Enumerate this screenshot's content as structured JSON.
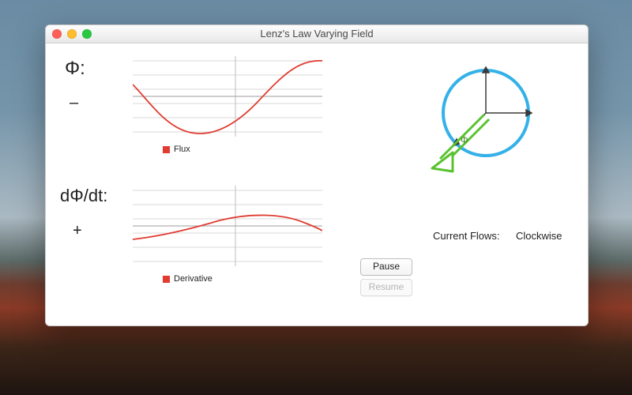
{
  "window": {
    "title": "Lenz's Law Varying Field"
  },
  "flux": {
    "symbol": "Φ:",
    "sign": "–",
    "legend": "Flux"
  },
  "derivative": {
    "symbol": "dΦ/dt:",
    "sign": "+",
    "legend": "Derivative"
  },
  "diagram": {
    "flux_label": "Φ"
  },
  "controls": {
    "pause_label": "Pause",
    "resume_label": "Resume"
  },
  "status": {
    "label": "Current Flows:",
    "value": "Clockwise"
  },
  "chart_data": [
    {
      "type": "line",
      "title": "Flux",
      "series": [
        {
          "name": "Flux",
          "x": [
            0.0,
            0.1,
            0.2,
            0.3,
            0.4,
            0.5,
            0.6,
            0.7,
            0.8,
            0.9,
            1.0
          ],
          "values": [
            0.3,
            -0.3,
            -0.75,
            -0.98,
            -0.92,
            -0.6,
            -0.1,
            0.4,
            0.8,
            0.97,
            0.9
          ]
        }
      ],
      "xlim": [
        0,
        1
      ],
      "ylim": [
        -1,
        1
      ],
      "grid": true
    },
    {
      "type": "line",
      "title": "Derivative",
      "series": [
        {
          "name": "Derivative",
          "x": [
            0.0,
            0.1,
            0.2,
            0.3,
            0.4,
            0.5,
            0.6,
            0.7,
            0.8,
            0.9,
            1.0
          ],
          "values": [
            -0.4,
            -0.28,
            -0.12,
            0.08,
            0.25,
            0.37,
            0.42,
            0.38,
            0.25,
            0.05,
            -0.13
          ]
        }
      ],
      "xlim": [
        0,
        1
      ],
      "ylim": [
        -1,
        1
      ],
      "grid": true
    }
  ]
}
